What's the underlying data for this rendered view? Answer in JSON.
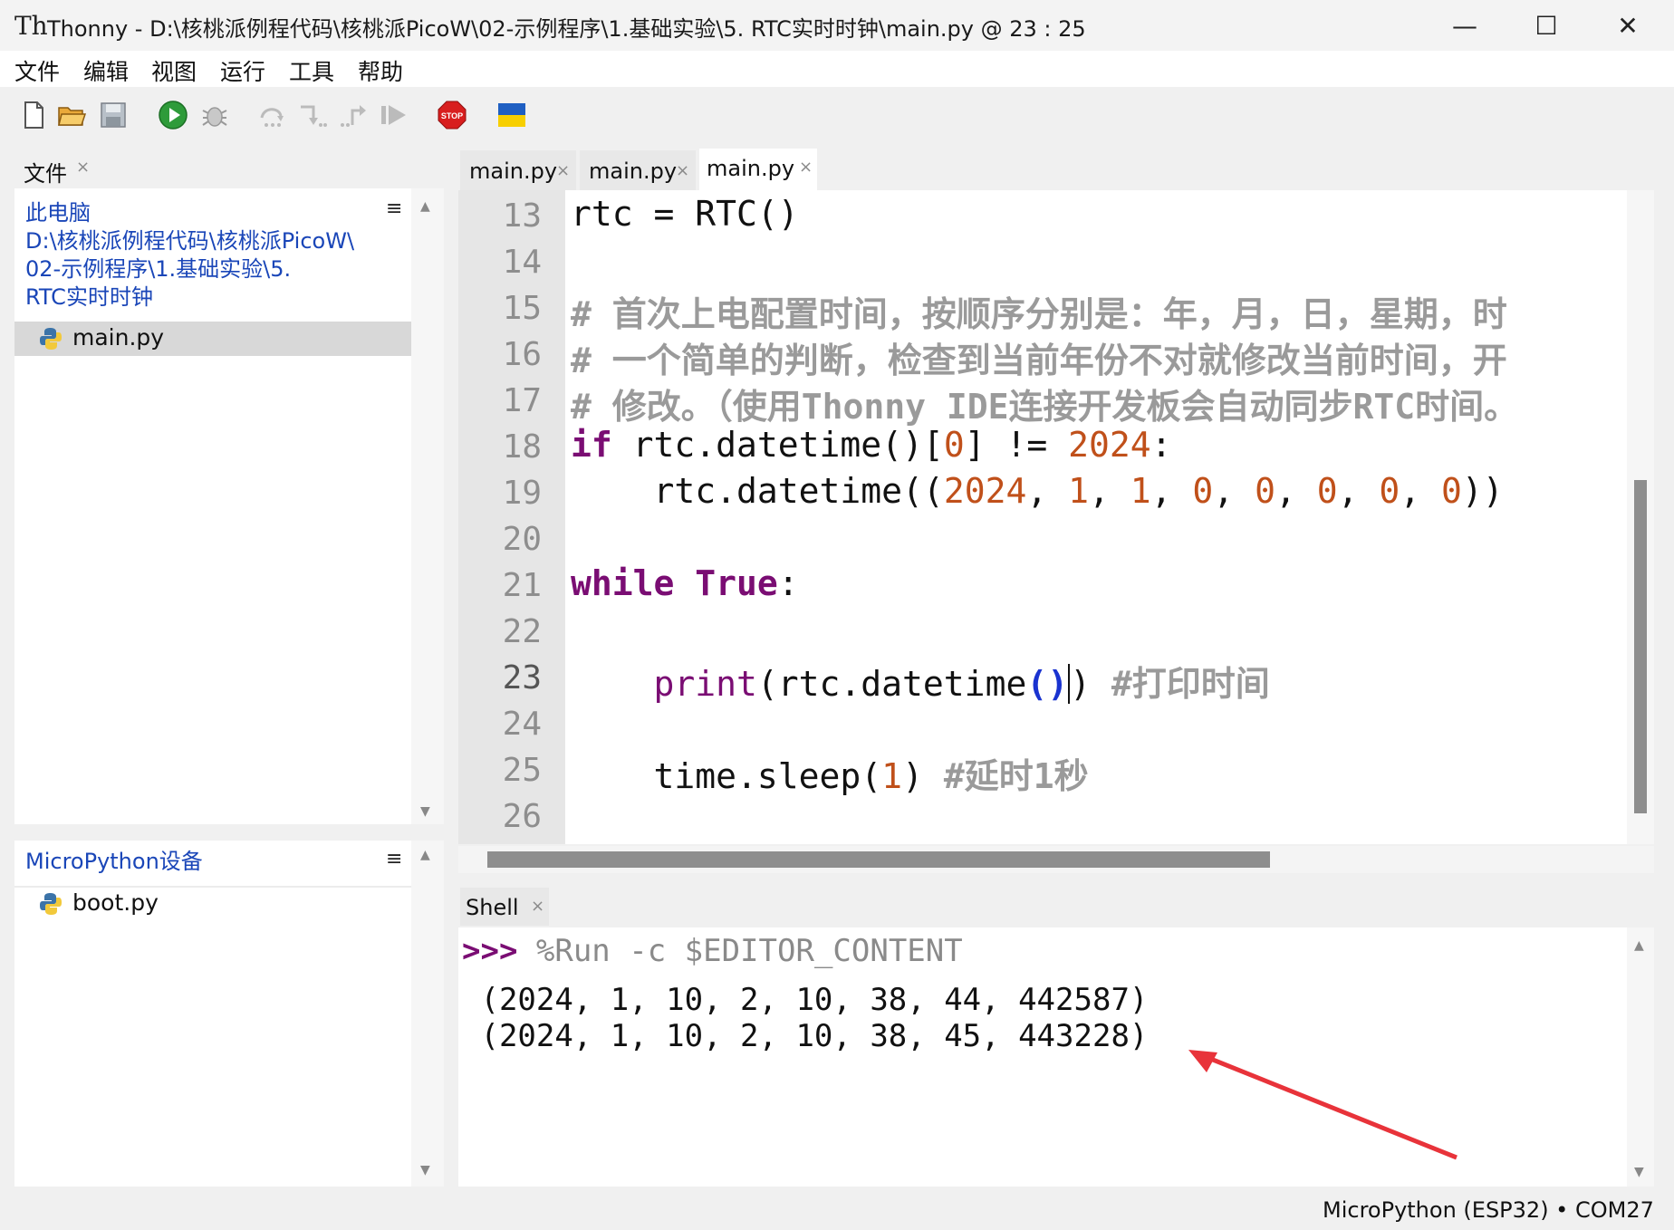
{
  "window": {
    "title": "Thonny  -  D:\\核桃派例程代码\\核桃派PicoW\\02-示例程序\\1.基础实验\\5. RTC实时时钟\\main.py  @  23 : 25",
    "logo": "Th",
    "minimize": "—",
    "maximize": "☐",
    "close": "✕"
  },
  "menu": [
    "文件",
    "编辑",
    "视图",
    "运行",
    "工具",
    "帮助"
  ],
  "toolbar": {
    "icons": [
      "new-file-icon",
      "open-file-icon",
      "save-icon",
      "run-icon",
      "debug-icon",
      "step-over-icon",
      "step-into-icon",
      "step-out-icon",
      "resume-icon",
      "stop-icon",
      "ukraine-flag-icon"
    ],
    "stop_label": "STOP"
  },
  "files_panel": {
    "tab_label": "文件",
    "tab_close": "×",
    "menu_icon": "≡",
    "path_lines": [
      "此电脑",
      "D:\\核桃派例程代码\\核桃派PicoW\\",
      "02-示例程序\\1.基础实验\\5.",
      "RTC实时时钟"
    ],
    "files": [
      "main.py"
    ]
  },
  "device_panel": {
    "title": "MicroPython设备",
    "menu_icon": "≡",
    "files": [
      "boot.py"
    ]
  },
  "editor": {
    "tabs": [
      {
        "label": "main.py",
        "close": "×"
      },
      {
        "label": "main.py",
        "close": "×"
      },
      {
        "label": "main.py",
        "close": "×"
      }
    ],
    "line_numbers": [
      "13",
      "14",
      "15",
      "16",
      "17",
      "18",
      "19",
      "20",
      "21",
      "22",
      "23",
      "24",
      "25",
      "26"
    ],
    "lines": {
      "l13": "rtc = RTC()",
      "l15": "# 首次上电配置时间，按顺序分别是：年，月，日，星期，时",
      "l16": "# 一个简单的判断，检查到当前年份不对就修改当前时间，开",
      "l17": "# 修改。（使用Thonny IDE连接开发板会自动同步RTC时间。",
      "l18": {
        "kw": "if",
        "a": " rtc.datetime()[",
        "n0": "0",
        "b": "] != ",
        "year": "2024",
        "c": ":"
      },
      "l19": {
        "a": "    rtc.datetime((",
        "n1": "2024",
        "s1": ", ",
        "n2": "1",
        "s2": ", ",
        "n3": "1",
        "s3": ", ",
        "n4": "0",
        "s4": ", ",
        "n5": "0",
        "s5": ", ",
        "n6": "0",
        "s6": ", ",
        "n7": "0",
        "s7": ", ",
        "n8": "0",
        "c": "))"
      },
      "l21": {
        "kw1": "while",
        "sp": " ",
        "kw2": "True",
        "c": ":"
      },
      "l23": {
        "indent": "    ",
        "fn": "print",
        "a": "(rtc.datetime",
        "p": "()",
        "b": ")",
        "cmt": " #打印时间"
      },
      "l25": {
        "a": "    time.sleep(",
        "n": "1",
        "b": ")",
        "cmt": " #延时1秒"
      }
    }
  },
  "shell": {
    "tab_label": "Shell",
    "tab_close": "×",
    "prompt": ">>>",
    "command": " %Run -c $EDITOR_CONTENT",
    "output": [
      " (2024, 1, 10, 2, 10, 38, 44, 442587)",
      " (2024, 1, 10, 2, 10, 38, 45, 443228)"
    ]
  },
  "status": {
    "interpreter": "MicroPython (ESP32)  •  COM27"
  },
  "colors": {
    "keyword": "#7a0d73",
    "number": "#c0501a",
    "comment": "#9a9a9a",
    "link": "#1a46b8",
    "annotation_arrow": "#e8333a"
  }
}
